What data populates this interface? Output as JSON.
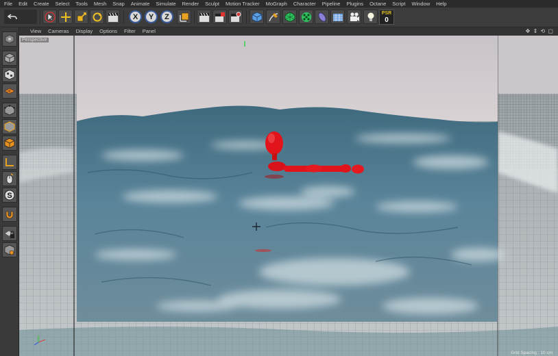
{
  "menu": [
    "File",
    "Edit",
    "Create",
    "Select",
    "Tools",
    "Mesh",
    "Snap",
    "Animate",
    "Simulate",
    "Render",
    "Sculpt",
    "Motion Tracker",
    "MoGraph",
    "Character",
    "Pipeline",
    "Plugins",
    "Octane",
    "Script",
    "Window",
    "Help"
  ],
  "toolbar": {
    "axis_x": "X",
    "axis_y": "Y",
    "axis_z": "Z",
    "psr_label": "PSR",
    "psr_value": "0"
  },
  "viewport": {
    "menu": [
      "View",
      "Cameras",
      "Display",
      "Options",
      "Filter",
      "Panel"
    ],
    "camera_label": "Perspective",
    "grid_spacing": "Grid Spacing : 10 cm",
    "nav_icons": "✥ ⇕ ⟲ ▢"
  },
  "colors": {
    "figure": "#e0141a",
    "sky": "#cfc9cd",
    "water": "#557e90"
  }
}
